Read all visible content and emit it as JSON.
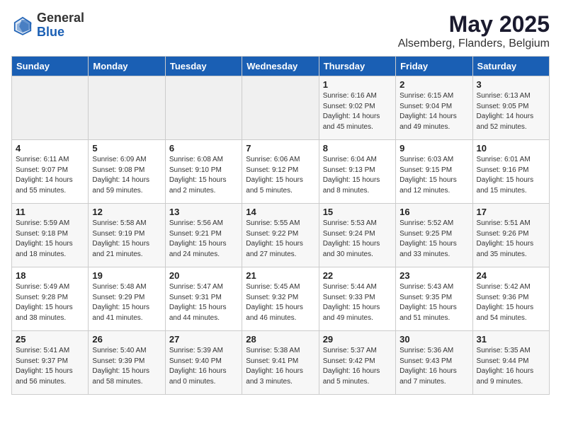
{
  "logo": {
    "general": "General",
    "blue": "Blue"
  },
  "title": "May 2025",
  "subtitle": "Alsemberg, Flanders, Belgium",
  "days_header": [
    "Sunday",
    "Monday",
    "Tuesday",
    "Wednesday",
    "Thursday",
    "Friday",
    "Saturday"
  ],
  "weeks": [
    [
      {
        "day": "",
        "info": ""
      },
      {
        "day": "",
        "info": ""
      },
      {
        "day": "",
        "info": ""
      },
      {
        "day": "",
        "info": ""
      },
      {
        "day": "1",
        "info": "Sunrise: 6:16 AM\nSunset: 9:02 PM\nDaylight: 14 hours\nand 45 minutes."
      },
      {
        "day": "2",
        "info": "Sunrise: 6:15 AM\nSunset: 9:04 PM\nDaylight: 14 hours\nand 49 minutes."
      },
      {
        "day": "3",
        "info": "Sunrise: 6:13 AM\nSunset: 9:05 PM\nDaylight: 14 hours\nand 52 minutes."
      }
    ],
    [
      {
        "day": "4",
        "info": "Sunrise: 6:11 AM\nSunset: 9:07 PM\nDaylight: 14 hours\nand 55 minutes."
      },
      {
        "day": "5",
        "info": "Sunrise: 6:09 AM\nSunset: 9:08 PM\nDaylight: 14 hours\nand 59 minutes."
      },
      {
        "day": "6",
        "info": "Sunrise: 6:08 AM\nSunset: 9:10 PM\nDaylight: 15 hours\nand 2 minutes."
      },
      {
        "day": "7",
        "info": "Sunrise: 6:06 AM\nSunset: 9:12 PM\nDaylight: 15 hours\nand 5 minutes."
      },
      {
        "day": "8",
        "info": "Sunrise: 6:04 AM\nSunset: 9:13 PM\nDaylight: 15 hours\nand 8 minutes."
      },
      {
        "day": "9",
        "info": "Sunrise: 6:03 AM\nSunset: 9:15 PM\nDaylight: 15 hours\nand 12 minutes."
      },
      {
        "day": "10",
        "info": "Sunrise: 6:01 AM\nSunset: 9:16 PM\nDaylight: 15 hours\nand 15 minutes."
      }
    ],
    [
      {
        "day": "11",
        "info": "Sunrise: 5:59 AM\nSunset: 9:18 PM\nDaylight: 15 hours\nand 18 minutes."
      },
      {
        "day": "12",
        "info": "Sunrise: 5:58 AM\nSunset: 9:19 PM\nDaylight: 15 hours\nand 21 minutes."
      },
      {
        "day": "13",
        "info": "Sunrise: 5:56 AM\nSunset: 9:21 PM\nDaylight: 15 hours\nand 24 minutes."
      },
      {
        "day": "14",
        "info": "Sunrise: 5:55 AM\nSunset: 9:22 PM\nDaylight: 15 hours\nand 27 minutes."
      },
      {
        "day": "15",
        "info": "Sunrise: 5:53 AM\nSunset: 9:24 PM\nDaylight: 15 hours\nand 30 minutes."
      },
      {
        "day": "16",
        "info": "Sunrise: 5:52 AM\nSunset: 9:25 PM\nDaylight: 15 hours\nand 33 minutes."
      },
      {
        "day": "17",
        "info": "Sunrise: 5:51 AM\nSunset: 9:26 PM\nDaylight: 15 hours\nand 35 minutes."
      }
    ],
    [
      {
        "day": "18",
        "info": "Sunrise: 5:49 AM\nSunset: 9:28 PM\nDaylight: 15 hours\nand 38 minutes."
      },
      {
        "day": "19",
        "info": "Sunrise: 5:48 AM\nSunset: 9:29 PM\nDaylight: 15 hours\nand 41 minutes."
      },
      {
        "day": "20",
        "info": "Sunrise: 5:47 AM\nSunset: 9:31 PM\nDaylight: 15 hours\nand 44 minutes."
      },
      {
        "day": "21",
        "info": "Sunrise: 5:45 AM\nSunset: 9:32 PM\nDaylight: 15 hours\nand 46 minutes."
      },
      {
        "day": "22",
        "info": "Sunrise: 5:44 AM\nSunset: 9:33 PM\nDaylight: 15 hours\nand 49 minutes."
      },
      {
        "day": "23",
        "info": "Sunrise: 5:43 AM\nSunset: 9:35 PM\nDaylight: 15 hours\nand 51 minutes."
      },
      {
        "day": "24",
        "info": "Sunrise: 5:42 AM\nSunset: 9:36 PM\nDaylight: 15 hours\nand 54 minutes."
      }
    ],
    [
      {
        "day": "25",
        "info": "Sunrise: 5:41 AM\nSunset: 9:37 PM\nDaylight: 15 hours\nand 56 minutes."
      },
      {
        "day": "26",
        "info": "Sunrise: 5:40 AM\nSunset: 9:39 PM\nDaylight: 15 hours\nand 58 minutes."
      },
      {
        "day": "27",
        "info": "Sunrise: 5:39 AM\nSunset: 9:40 PM\nDaylight: 16 hours\nand 0 minutes."
      },
      {
        "day": "28",
        "info": "Sunrise: 5:38 AM\nSunset: 9:41 PM\nDaylight: 16 hours\nand 3 minutes."
      },
      {
        "day": "29",
        "info": "Sunrise: 5:37 AM\nSunset: 9:42 PM\nDaylight: 16 hours\nand 5 minutes."
      },
      {
        "day": "30",
        "info": "Sunrise: 5:36 AM\nSunset: 9:43 PM\nDaylight: 16 hours\nand 7 minutes."
      },
      {
        "day": "31",
        "info": "Sunrise: 5:35 AM\nSunset: 9:44 PM\nDaylight: 16 hours\nand 9 minutes."
      }
    ]
  ]
}
